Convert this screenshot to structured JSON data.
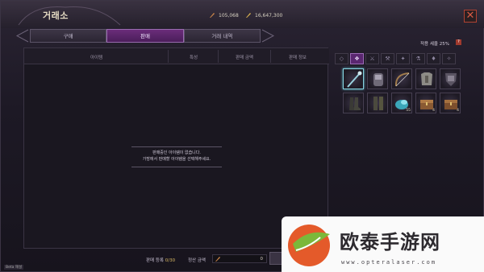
{
  "window": {
    "title": "거래소"
  },
  "currency": {
    "silver": "105,068",
    "gold": "16,647,300"
  },
  "tabs": [
    {
      "label": "구매"
    },
    {
      "label": "판매"
    },
    {
      "label": "거래 내역"
    }
  ],
  "table": {
    "headers": [
      "아이템",
      "특성",
      "판매 금액",
      "판매 정보"
    ],
    "empty_line1": "판매중인 아이템이 없습니다.",
    "empty_line2": "가방에서 판매할 아이템을 선택해주세요."
  },
  "fee": {
    "label": "적용 세율 25%"
  },
  "inventory": {
    "quantities": [
      "",
      "",
      "",
      "",
      "",
      "",
      "",
      "",
      "",
      ""
    ],
    "qty_labels": {
      "slot8": "55",
      "slot9": "4",
      "slot10": "4"
    }
  },
  "footer": {
    "register_label": "판매 등록",
    "register_count": "0/30",
    "settle_label": "정산 금액",
    "settle_value": "0"
  },
  "badge": "Beta 해설",
  "watermark": {
    "brand": "欧泰手游网",
    "url": "www.opteralaser.com"
  }
}
